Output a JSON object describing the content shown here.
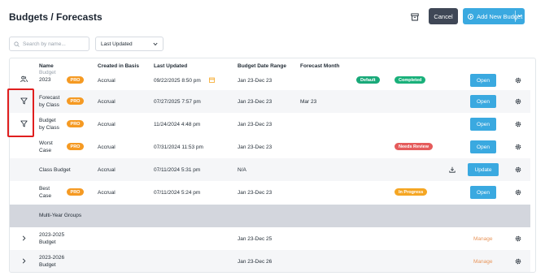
{
  "header": {
    "title": "Budgets / Forecasts",
    "cancel_label": "Cancel",
    "add_label": "Add New Budget"
  },
  "toolbar": {
    "search_placeholder": "Search by name...",
    "sort_value": "Last Updated"
  },
  "table": {
    "columns": [
      "Name",
      "Created in Basis",
      "Last Updated",
      "Budget Date Range",
      "Forecast Month"
    ],
    "rows": [
      {
        "name_line1": "Budget",
        "name_line2": "2023",
        "pro": "PRO",
        "created": "Accrual",
        "updated": "09/22/2025 8:50 pm",
        "range": "Jan 23-Dec 23",
        "forecast": "",
        "badge1": "Default",
        "badge2": "Completed",
        "action": "Open"
      },
      {
        "name_line1": "Forecast",
        "name_line2": "by Class",
        "pro": "PRO",
        "created": "Accrual",
        "updated": "07/27/2025 7:57 pm",
        "range": "Jan 23-Dec 23",
        "forecast": "Mar 23",
        "action": "Open"
      },
      {
        "name_line1": "Budget",
        "name_line2": "by Class",
        "pro": "PRO",
        "created": "Accrual",
        "updated": "11/24/2024 4:48 pm",
        "range": "Jan 23-Dec 23",
        "forecast": "",
        "action": "Open"
      },
      {
        "name_line1": "Worst",
        "name_line2": "Case",
        "pro": "PRO",
        "created": "Accrual",
        "updated": "07/31/2024 11:53 pm",
        "range": "Jan 23-Dec 23",
        "forecast": "",
        "badge2": "Needs Review",
        "action": "Open"
      },
      {
        "name_line1": "Class Budget",
        "created": "Accrual",
        "updated": "07/11/2024 5:31 pm",
        "range": "N/A",
        "action": "Update"
      },
      {
        "name_line1": "Best",
        "name_line2": "Case",
        "pro": "PRO",
        "created": "Accrual",
        "updated": "07/11/2024 5:24 pm",
        "range": "Jan 23-Dec 23",
        "badge2": "In Progress",
        "action": "Open"
      }
    ],
    "group_label": "Multi-Year Groups",
    "groups": [
      {
        "name_line1": "2023-2025",
        "name_line2": "Budget",
        "range": "Jan 23-Dec 25",
        "action": "Manage"
      },
      {
        "name_line1": "2023-2026",
        "name_line2": "Budget",
        "range": "Jan 23-Dec 26",
        "action": "Manage"
      }
    ]
  },
  "colors": {
    "accent": "#3aa9e0",
    "pro": "#f59a23",
    "default": "#19a979",
    "needs_review": "#e55b5b",
    "in_progress": "#f5a623",
    "manage": "#e8955a",
    "highlight": "#e01e1e"
  },
  "icons": [
    "archive-icon",
    "plus-circle-icon",
    "chevron-down-icon",
    "search-icon",
    "users-icon",
    "filter-icon",
    "download-icon",
    "gear-icon",
    "chevron-right-icon"
  ]
}
